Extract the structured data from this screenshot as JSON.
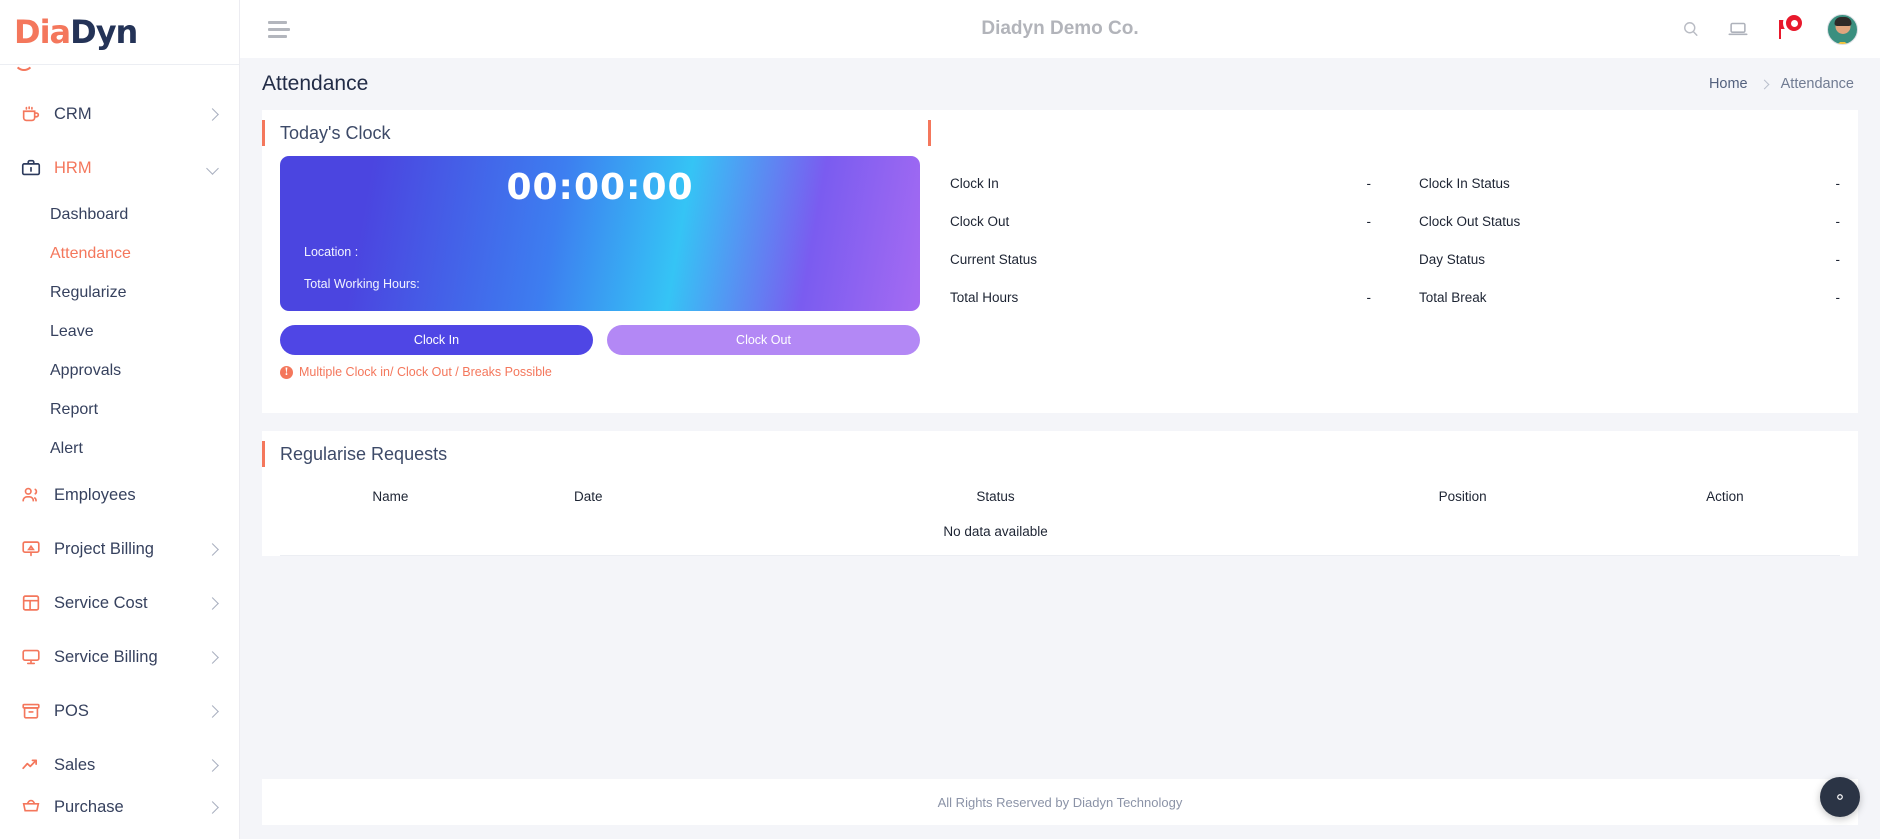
{
  "brand": {
    "part1": "Dia",
    "part2": "Dyn",
    "accent": "#f4775c",
    "dark": "#243357"
  },
  "header": {
    "company": "Diadyn Demo Co.",
    "menu_icon": "hamburger-icon",
    "search_icon": "search-icon",
    "screen_icon": "laptop-icon",
    "notification_icon": "notification-flag-icon",
    "avatar_icon": "user-avatar"
  },
  "page": {
    "title": "Attendance",
    "breadcrumb": {
      "home": "Home",
      "current": "Attendance"
    }
  },
  "sidebar": {
    "items": [
      {
        "label": "CRM",
        "icon": "coffee-cup-icon",
        "chevron": "right",
        "active": false
      },
      {
        "label": "HRM",
        "icon": "briefcase-icon",
        "chevron": "down",
        "active": true
      },
      {
        "label": "Employees",
        "icon": "users-icon",
        "chevron": "none",
        "active": false
      },
      {
        "label": "Project Billing",
        "icon": "projector-icon",
        "chevron": "right",
        "active": false
      },
      {
        "label": "Service Cost",
        "icon": "layout-grid-icon",
        "chevron": "right",
        "active": false
      },
      {
        "label": "Service Billing",
        "icon": "monitor-icon",
        "chevron": "right",
        "active": false
      },
      {
        "label": "POS",
        "icon": "archive-box-icon",
        "chevron": "right",
        "active": false
      },
      {
        "label": "Sales",
        "icon": "trending-up-icon",
        "chevron": "right",
        "active": false
      },
      {
        "label": "Purchase",
        "icon": "cart-icon",
        "chevron": "right",
        "active": false
      }
    ],
    "hrm_sub": [
      {
        "label": "Dashboard",
        "active": false
      },
      {
        "label": "Attendance",
        "active": true
      },
      {
        "label": "Regularize",
        "active": false
      },
      {
        "label": "Leave",
        "active": false
      },
      {
        "label": "Approvals",
        "active": false
      },
      {
        "label": "Report",
        "active": false
      },
      {
        "label": "Alert",
        "active": false
      }
    ]
  },
  "clock_card": {
    "title": "Today's Clock",
    "time": "00:00:00",
    "location_label": "Location :",
    "working_hours_label": "Total Working Hours:",
    "clock_in_button": "Clock In",
    "clock_out_button": "Clock Out",
    "warning": "Multiple Clock in/ Clock Out / Breaks Possible",
    "warning_icon": "info-icon",
    "stats": [
      {
        "key": "Clock In",
        "value": "-"
      },
      {
        "key": "Clock In Status",
        "value": "-"
      },
      {
        "key": "Clock Out",
        "value": "-"
      },
      {
        "key": "Clock Out Status",
        "value": "-"
      },
      {
        "key": "Current Status",
        "value": ""
      },
      {
        "key": "Day Status",
        "value": "-"
      },
      {
        "key": "Total Hours",
        "value": "-"
      },
      {
        "key": "Total Break",
        "value": "-"
      }
    ]
  },
  "regularise": {
    "title": "Regularise Requests",
    "columns": [
      "Name",
      "Date",
      "Status",
      "Position",
      "Action"
    ],
    "empty_message": "No data available",
    "rows": []
  },
  "footer": {
    "text": "All Rights Reserved by Diadyn Technology"
  },
  "fab": {
    "icon": "gear-icon"
  },
  "colors": {
    "accent_orange": "#f4775c",
    "clock_in": "#4f46e5",
    "clock_out": "#b388f5",
    "notification_red": "#e8192c",
    "page_bg": "#f4f5f9"
  }
}
